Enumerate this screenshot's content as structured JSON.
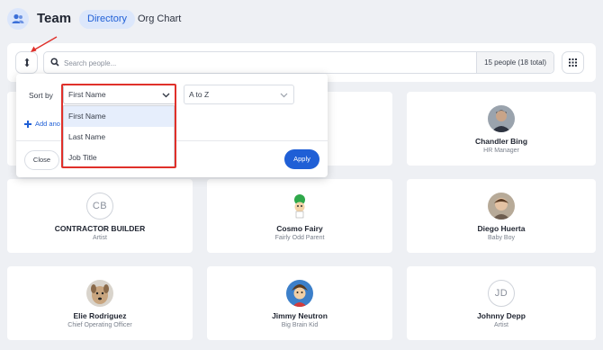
{
  "app": {
    "title": "Team",
    "icon": "people-icon"
  },
  "nav": {
    "tabs": [
      {
        "label": "Directory",
        "active": true
      },
      {
        "label": "Org Chart",
        "active": false
      }
    ]
  },
  "toolbar": {
    "search_placeholder": "Search people...",
    "count_text": "15 people (18 total)"
  },
  "sort_popover": {
    "sort_label": "Sort by",
    "field_value": "First Name",
    "field_options": [
      "First Name",
      "Last Name",
      "Job Title"
    ],
    "order_value": "A to Z",
    "add_another": "Add ano",
    "close_label": "Close",
    "apply_label": "Apply"
  },
  "people": [
    {
      "name": "Chandler Bing",
      "title": "HR Manager",
      "initials": ""
    },
    {
      "name": "CONTRACTOR BUILDER",
      "title": "Artist",
      "initials": "CB"
    },
    {
      "name": "Cosmo Fairy",
      "title": "Fairly Odd Parent",
      "initials": ""
    },
    {
      "name": "Diego Huerta",
      "title": "Baby Boy",
      "initials": ""
    },
    {
      "name": "Elie Rodriguez",
      "title": "Chief Operating Officer",
      "initials": ""
    },
    {
      "name": "Jimmy Neutron",
      "title": "Big Brain Kid",
      "initials": ""
    },
    {
      "name": "Johnny Depp",
      "title": "Artist",
      "initials": "JD"
    }
  ],
  "colors": {
    "accent": "#1f5fd6",
    "annotation": "#e0302a",
    "background": "#eef0f4"
  }
}
